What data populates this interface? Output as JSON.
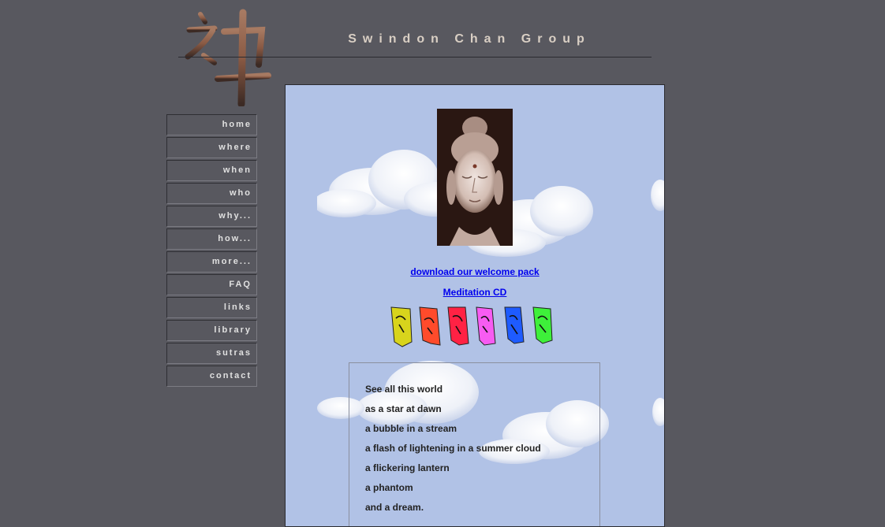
{
  "header": {
    "title": "Swindon Chan Group",
    "logo_icon": "chan-character-logo"
  },
  "nav": {
    "items": [
      {
        "label": "home"
      },
      {
        "label": "where"
      },
      {
        "label": "when"
      },
      {
        "label": "who"
      },
      {
        "label": "why..."
      },
      {
        "label": "how..."
      },
      {
        "label": "more..."
      },
      {
        "label": "FAQ"
      },
      {
        "label": "links"
      },
      {
        "label": "library"
      },
      {
        "label": "sutras"
      },
      {
        "label": "contact"
      }
    ]
  },
  "main": {
    "image_icon": "buddha-head-image",
    "links": {
      "welcome_pack": "download our welcome pack",
      "meditation_cd": "Meditation CD"
    },
    "flags_icon": "prayer-flags",
    "poem": [
      "See all this world",
      "as a star at dawn",
      "a bubble in a stream",
      "a flash of lightening in a summer cloud",
      "a flickering lantern",
      "a phantom",
      "and a dream."
    ]
  },
  "colors": {
    "background": "#58585f",
    "content_bg": "#b1c2e6",
    "link": "#0000ee",
    "title": "#d9cfc4"
  }
}
